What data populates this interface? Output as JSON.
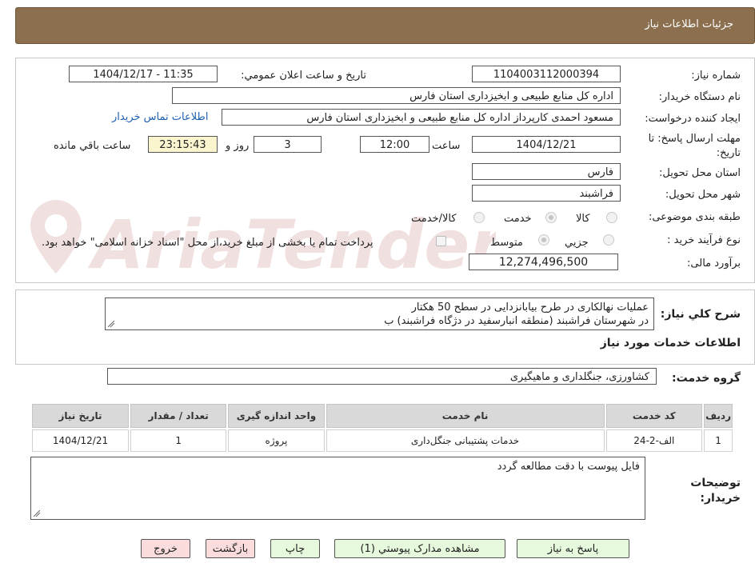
{
  "header": {
    "title": "جزئیات اطلاعات نیاز"
  },
  "form": {
    "need_number_label": "شماره نیاز:",
    "need_number": "1104003112000394",
    "announce_label": "تاریخ و ساعت اعلان عمومي:",
    "announce_value": "1404/12/17 - 11:35",
    "buyer_org_label": "نام دستگاه خریدار:",
    "buyer_org": "اداره کل منابع طبیعی و ابخیزداری استان فارس",
    "requester_label": "ایجاد کننده درخواست:",
    "requester": "مسعود احمدی کارپرداز اداره کل منابع طبیعی و ابخیزداری استان فارس",
    "contact_link": "اطلاعات تماس خریدار",
    "deadline_label": "مهلت ارسال پاسخ: تا تاریخ:",
    "deadline_date": "1404/12/21",
    "time_label": "ساعت",
    "deadline_time": "12:00",
    "days_value": "3",
    "days_label": "روز و",
    "remaining_time": "23:15:43",
    "remaining_label": "ساعت باقي مانده",
    "province_label": "استان محل تحویل:",
    "province": "فارس",
    "city_label": "شهر محل تحویل:",
    "city": "فراشبند",
    "category_label": "طبقه بندی موضوعی:",
    "category_options": [
      "کالا",
      "خدمت",
      "کالا/خدمت"
    ],
    "category_selected": "خدمت",
    "process_label": "نوع فرآیند خرید :",
    "process_options": [
      "جزیي",
      "متوسط"
    ],
    "process_selected": "متوسط",
    "payment_note": "پرداخت تمام یا بخشی از مبلغ خرید،از محل \"اسناد خزانه اسلامی\" خواهد بود.",
    "budget_label": "برآورد مالی:",
    "budget": "12,274,496,500"
  },
  "description": {
    "label": "شرح کلي نیاز:",
    "line1": "عملیات نهالکاری  در طرح بیابانزدایی در سطح 50 هکتار",
    "line2": "در شهرستان فراشبند (منطقه انبارسفید در دژگاه فراشبند) ب"
  },
  "services": {
    "section_title": "اطلاعات خدمات مورد نیاز",
    "group_label": "گروه خدمت:",
    "group_value": "کشاورزی، جنگلداری و ماهیگیری",
    "columns": [
      "ردیف",
      "کد خدمت",
      "نام خدمت",
      "واحد اندازه گیری",
      "تعداد / مقدار",
      "تاریخ نیاز"
    ],
    "rows": [
      {
        "row": "1",
        "code": "الف-2-24",
        "name": "خدمات پشتیبانی جنگل‌داری",
        "unit": "پروژه",
        "qty": "1",
        "date": "1404/12/21"
      }
    ]
  },
  "buyer_notes": {
    "label": "توضیحات خریدار:",
    "text": "فایل پیوست با دقت مطالعه گردد"
  },
  "buttons": {
    "reply": "پاسخ به نیاز",
    "attachments": "مشاهده مدارک پیوستي (1)",
    "print": "چاپ",
    "back": "بازگشت",
    "exit": "خروج"
  },
  "watermark": {
    "text": "AriaTender.neT"
  },
  "colors": {
    "header_bg": "#8b6f4e",
    "button_green": "#e6f9dc",
    "button_pink": "#fbdcdc",
    "highlight_yellow": "#fbf5cf",
    "link_blue": "#1e5fb0"
  }
}
